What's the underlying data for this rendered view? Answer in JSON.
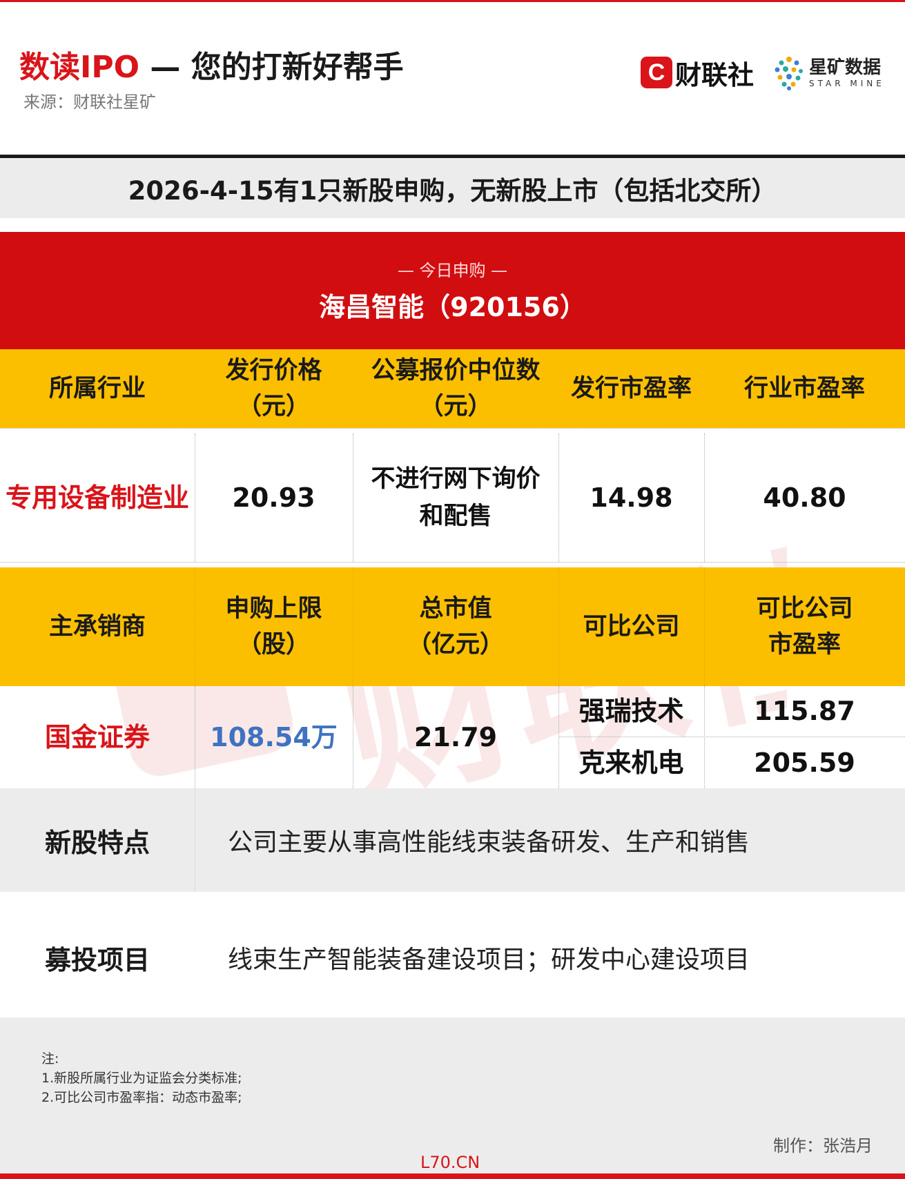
{
  "header": {
    "title_red": "数读IPO",
    "title_rest": " — 您的打新好帮手",
    "source": "来源：财联社星矿",
    "logo_cls_letter": "C",
    "logo_cls_text": "财联社",
    "logo_star_cn": "星矿数据",
    "logo_star_en": "STAR MINE"
  },
  "summary": "2026-4-15有1只新股申购，无新股上市（包括北交所）",
  "today": {
    "tag": "— 今日申购 —",
    "stock": "海昌智能（920156）"
  },
  "table1": {
    "headers": [
      [
        "所属行业",
        ""
      ],
      [
        "发行价格",
        "（元）"
      ],
      [
        "公募报价中位数",
        "（元）"
      ],
      [
        "发行市盈率",
        ""
      ],
      [
        "行业市盈率",
        ""
      ]
    ],
    "values": [
      [
        "专用设备制造业",
        ""
      ],
      [
        "20.93",
        ""
      ],
      [
        "不进行网下询价",
        "和配售"
      ],
      [
        "14.98",
        ""
      ],
      [
        "40.80",
        ""
      ]
    ]
  },
  "table2": {
    "headers": [
      [
        "主承销商",
        ""
      ],
      [
        "申购上限",
        "（股）"
      ],
      [
        "总市值",
        "（亿元）"
      ],
      [
        "可比公司",
        ""
      ],
      [
        "可比公司",
        "市盈率"
      ]
    ],
    "underwriter": "国金证券",
    "limit": "108.54万",
    "market_cap": "21.79",
    "comparables": [
      {
        "name": "强瑞技术",
        "pe": "115.87"
      },
      {
        "name": "克来机电",
        "pe": "205.59"
      }
    ]
  },
  "features": {
    "label": "新股特点",
    "text": "公司主要从事高性能线束装备研发、生产和销售"
  },
  "projects": {
    "label": "募投项目",
    "text": "线束生产智能装备建设项目；研发中心建设项目"
  },
  "notes": [
    "注:",
    "1.新股所属行业为证监会分类标准;",
    "2.可比公司市盈率指：动态市盈率;"
  ],
  "author": "制作：张浩月",
  "watermark_site": "L70.CN",
  "watermark_text": "财联社",
  "colors": {
    "brand_red": "#d10d10",
    "header_yellow": "#fcbf00",
    "link_blue": "#3f72c0",
    "band_grey": "#ececec"
  }
}
